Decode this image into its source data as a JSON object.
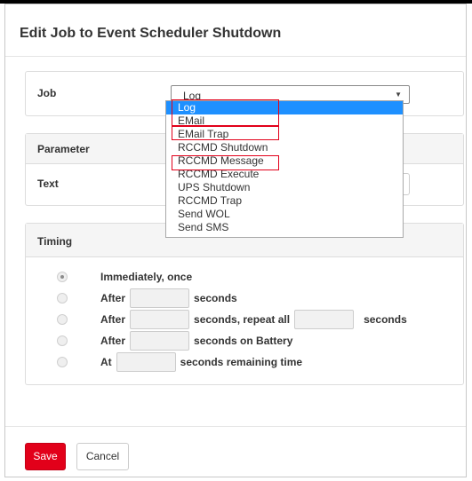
{
  "dialog": {
    "title": "Edit Job to Event Scheduler Shutdown"
  },
  "job_panel": {
    "label": "Job",
    "select_value": "Log",
    "select_arrow_icon": "caret-down-icon",
    "options": [
      "Log",
      "EMail",
      "EMail Trap",
      "RCCMD Shutdown",
      "RCCMD Message",
      "RCCMD Execute",
      "UPS Shutdown",
      "RCCMD Trap",
      "Send WOL",
      "Send SMS"
    ],
    "selected_option": "Log",
    "highlighted_options": [
      "Log",
      "EMail",
      "EMail Trap",
      "RCCMD Message"
    ]
  },
  "parameter_panel": {
    "heading": "Parameter",
    "text_label": "Text",
    "text_value": ""
  },
  "timing_panel": {
    "heading": "Timing",
    "selected_option": "Immediately, once",
    "rows": {
      "immediately": {
        "label": "Immediately, once"
      },
      "after": {
        "prefix": "After",
        "suffix": "seconds",
        "value": ""
      },
      "after_repeat": {
        "prefix": "After",
        "middle": "seconds, repeat all",
        "suffix": "seconds",
        "value": "",
        "repeat_value": ""
      },
      "after_battery": {
        "prefix": "After",
        "suffix": "seconds on Battery",
        "value": ""
      },
      "at_remaining": {
        "prefix": "At",
        "suffix": "seconds remaining time",
        "value": ""
      }
    }
  },
  "footer": {
    "save_label": "Save",
    "cancel_label": "Cancel"
  },
  "colors": {
    "save_button": "#e2001a",
    "highlight_border": "#e2001a",
    "dropdown_selection": "#1e90ff",
    "panel_heading_bg": "#f5f5f5"
  }
}
